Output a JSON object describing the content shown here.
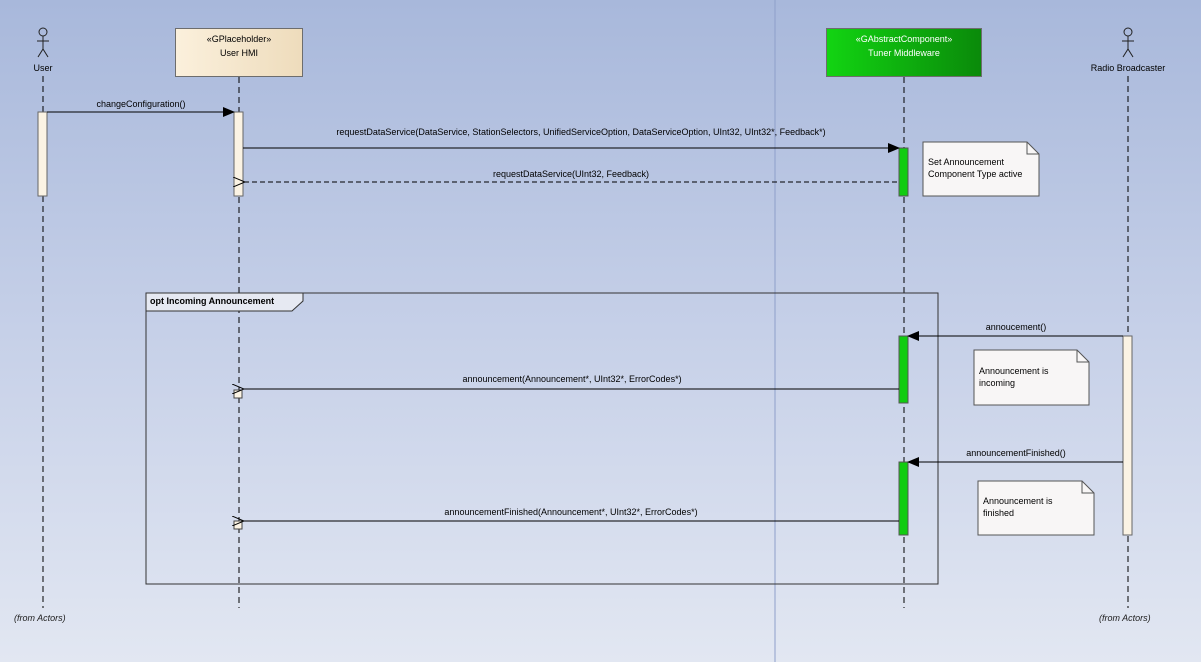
{
  "actors": {
    "user": {
      "label": "User",
      "footer": "(from Actors)"
    },
    "radio": {
      "label": "Radio Broadcaster",
      "footer": "(from Actors)"
    }
  },
  "lifelines": {
    "hmi": {
      "stereotype": "«GPlaceholder»",
      "name": "User HMI"
    },
    "middleware": {
      "stereotype": "«GAbstractComponent»",
      "name": "Tuner Middleware",
      "color": "#12c412"
    }
  },
  "messages": {
    "m1": "changeConfiguration()",
    "m2": "requestDataService(DataService, StationSelectors, UnifiedServiceOption, DataServiceOption, UInt32, UInt32*, Feedback*)",
    "m3": "requestDataService(UInt32, Feedback)",
    "m4": "annoucement()",
    "m5": "announcement(Announcement*, UInt32*, ErrorCodes*)",
    "m6": "announcementFinished()",
    "m7": "announcementFinished(Announcement*, UInt32*, ErrorCodes*)"
  },
  "notes": {
    "n1": {
      "line1": "Set Announcement",
      "line2": "Component Type active"
    },
    "n2": {
      "line1": "Announcement is",
      "line2": "incoming"
    },
    "n3": {
      "line1": "Announcement is",
      "line2": "finished"
    }
  },
  "fragment": {
    "title": "opt Incoming Announcement"
  }
}
